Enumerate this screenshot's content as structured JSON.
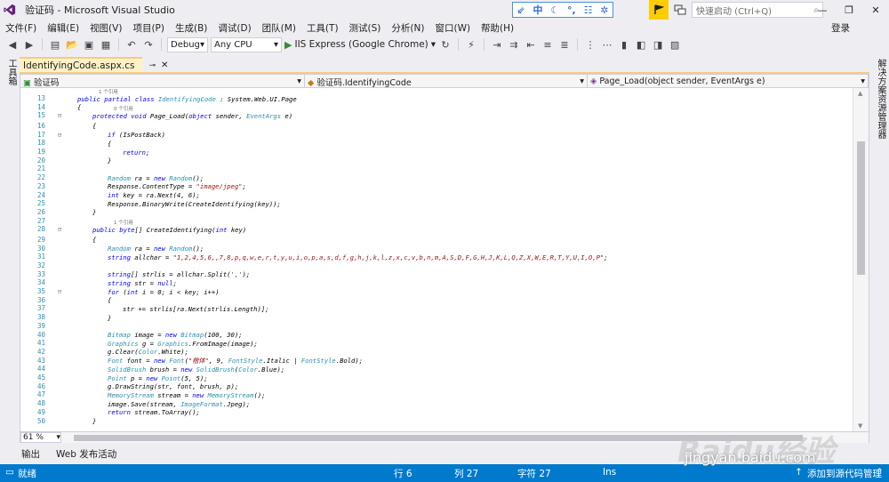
{
  "window": {
    "title": "验证码 - Microsoft Visual Studio",
    "ime_items": [
      "中"
    ],
    "quick_launch_placeholder": "快速启动 (Ctrl+Q)",
    "login": "登录"
  },
  "menu": [
    "文件(F)",
    "编辑(E)",
    "视图(V)",
    "项目(P)",
    "生成(B)",
    "调试(D)",
    "团队(M)",
    "工具(T)",
    "测试(S)",
    "分析(N)",
    "窗口(W)",
    "帮助(H)"
  ],
  "toolbar": {
    "config": "Debug",
    "platform": "Any CPU",
    "run_label": "IIS Express (Google Chrome)"
  },
  "side": {
    "left_tab": "工具箱",
    "right_tab": "解决方案资源管理器"
  },
  "document": {
    "tab_label": "IdentifyingCode.aspx.cs",
    "nav_project": "验证码",
    "nav_class": "验证码.IdentifyingCode",
    "nav_member": "Page_Load(object sender, EventArgs e)"
  },
  "code": {
    "ref_labels": [
      "1 个引用",
      "0 个引用",
      "1 个引用"
    ],
    "lines": [
      {
        "n": "13",
        "text": "public partial class IdentifyingCode : System.Web.UI.Page"
      },
      {
        "n": "14",
        "text": "{"
      },
      {
        "n": "15",
        "text": "protected void Page_Load(object sender, EventArgs e)"
      },
      {
        "n": "16",
        "text": "{"
      },
      {
        "n": "17",
        "text": "if (IsPostBack)"
      },
      {
        "n": "18",
        "text": "{"
      },
      {
        "n": "19",
        "text": "return;"
      },
      {
        "n": "20",
        "text": "}"
      },
      {
        "n": "21",
        "text": ""
      },
      {
        "n": "22",
        "text": "Random ra = new Random();"
      },
      {
        "n": "23",
        "text": "Response.ContentType = \"image/jpeg\";"
      },
      {
        "n": "24",
        "text": "int key = ra.Next(4, 6);"
      },
      {
        "n": "25",
        "text": "Response.BinaryWrite(CreateIdentifying(key));"
      },
      {
        "n": "26",
        "text": "}"
      },
      {
        "n": "27",
        "text": ""
      },
      {
        "n": "28",
        "text": "public byte[] CreateIdentifying(int key)"
      },
      {
        "n": "29",
        "text": "{"
      },
      {
        "n": "30",
        "text": "Random ra = new Random();"
      },
      {
        "n": "31",
        "text": "string allchar = \"1,2,4,5,6,,7,8,p,q,w,e,r,t,y,u,i,o,p,a,s,d,f,g,h,j,k,l,z,x,c,v,b,n,m,A,S,D,F,G,H,J,K,L,Q,Z,X,W,E,R,T,Y,U,I,O,P\";"
      },
      {
        "n": "32",
        "text": ""
      },
      {
        "n": "33",
        "text": "string[] strlis = allchar.Split(',');"
      },
      {
        "n": "34",
        "text": "string str = null;"
      },
      {
        "n": "35",
        "text": "for (int i = 0; i < key; i++)"
      },
      {
        "n": "36",
        "text": "{"
      },
      {
        "n": "37",
        "text": "str += strlis[ra.Next(strlis.Length)];"
      },
      {
        "n": "38",
        "text": "}"
      },
      {
        "n": "39",
        "text": ""
      },
      {
        "n": "40",
        "text": "Bitmap image = new Bitmap(100, 30);"
      },
      {
        "n": "41",
        "text": "Graphics g = Graphics.FromImage(image);"
      },
      {
        "n": "42",
        "text": "g.Clear(Color.White);"
      },
      {
        "n": "43",
        "text": "Font font = new Font(\"楷体\", 9, FontStyle.Italic | FontStyle.Bold);"
      },
      {
        "n": "44",
        "text": "SolidBrush brush = new SolidBrush(Color.Blue);"
      },
      {
        "n": "45",
        "text": "Point p = new Point(5, 5);"
      },
      {
        "n": "46",
        "text": "g.DrawString(str, font, brush, p);"
      },
      {
        "n": "47",
        "text": "MemoryStream stream = new MemoryStream();"
      },
      {
        "n": "48",
        "text": "image.Save(stream, ImageFormat.Jpeg);"
      },
      {
        "n": "49",
        "text": "return stream.ToArray();"
      },
      {
        "n": "50",
        "text": "}"
      }
    ]
  },
  "editor": {
    "zoom": "61 %"
  },
  "output_tabs": [
    "输出",
    "Web 发布活动"
  ],
  "status": {
    "ready": "就绪",
    "row": "行 6",
    "col": "列 27",
    "ch": "字符 27",
    "mode": "Ins",
    "source_control": "添加到源代码管理"
  },
  "watermark": {
    "brand": "Baidu经验",
    "url": "jingyan.baidu.com"
  },
  "colors": {
    "keyword": "#0000ff",
    "type": "#2b91af",
    "string": "#a31515",
    "status_bar": "#007acc",
    "tab_active": "#fff1c6"
  }
}
